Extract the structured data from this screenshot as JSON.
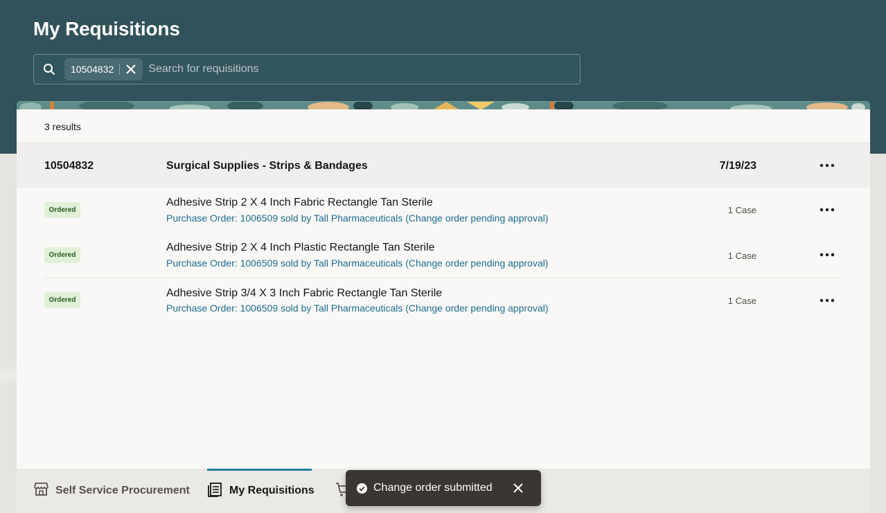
{
  "page": {
    "title": "My Requisitions"
  },
  "search": {
    "chip_value": "10504832",
    "placeholder": "Search for requisitions"
  },
  "results": {
    "count_label": "3 results"
  },
  "requisition": {
    "number": "10504832",
    "description": "Surgical Supplies - Strips & Bandages",
    "date": "7/19/23"
  },
  "lines": [
    {
      "status": "Ordered",
      "name": "Adhesive Strip 2 X 4 Inch Fabric Rectangle Tan Sterile",
      "po": "Purchase Order: 1006509 sold by Tall Pharmaceuticals (Change order pending approval)",
      "quantity": "1 Case"
    },
    {
      "status": "Ordered",
      "name": "Adhesive Strip 2 X 4 Inch Plastic Rectangle Tan Sterile",
      "po": "Purchase Order: 1006509 sold by Tall Pharmaceuticals (Change order pending approval)",
      "quantity": "1 Case"
    },
    {
      "status": "Ordered",
      "name": "Adhesive Strip 3/4 X 3 Inch Fabric Rectangle Tan Sterile",
      "po": "Purchase Order: 1006509 sold by Tall Pharmaceuticals (Change order pending approval)",
      "quantity": "1 Case"
    }
  ],
  "bottom_nav": {
    "items": [
      {
        "label": "Self Service Procurement",
        "icon": "store-icon",
        "active": false
      },
      {
        "label": "My Requisitions",
        "icon": "list-icon",
        "active": true
      },
      {
        "label": "",
        "icon": "cart-icon",
        "active": false
      }
    ]
  },
  "toast": {
    "message": "Change order submitted",
    "icon": "check-circle-icon"
  },
  "colors": {
    "header": "#31525a",
    "link": "#1b6b8f",
    "badge_bg": "#e0f1d7",
    "badge_text": "#265c24",
    "active_tab": "#227e9e",
    "toast_bg": "#3a3631"
  }
}
